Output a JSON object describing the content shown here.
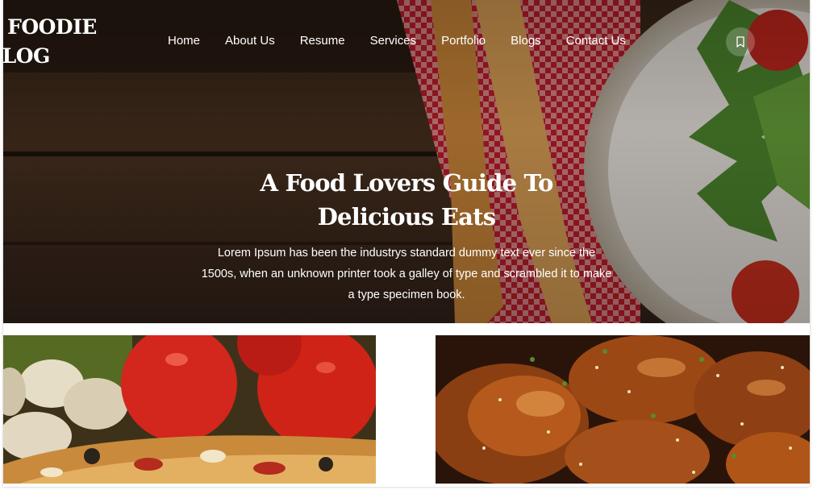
{
  "site": {
    "logo_line1": "A FOODIE",
    "logo_line2": "BLOG"
  },
  "nav": {
    "items": [
      {
        "label": "Home"
      },
      {
        "label": "About Us"
      },
      {
        "label": "Resume"
      },
      {
        "label": "Services"
      },
      {
        "label": "Portfolio"
      },
      {
        "label": "Blogs"
      },
      {
        "label": "Contact Us"
      }
    ],
    "bookmark_icon": "bookmark-icon"
  },
  "hero": {
    "title_line1": "A Food Lovers Guide To",
    "title_line2": "Delicious Eats",
    "text_line1": "Lorem Ipsum has been the industrys standard dummy text ever since the",
    "text_line2": "1500s, when an unknown printer took a galley of type and scrambled it to make",
    "text_line3": "a type specimen book."
  },
  "cards": [
    {
      "image": "pizza-tomatoes-mushrooms-photo"
    },
    {
      "image": "glazed-chicken-sesame-photo"
    }
  ],
  "colors": {
    "text_on_hero": "#ffffff",
    "wood_dark": "#2b1c12",
    "checker_red": "#c8202a"
  }
}
